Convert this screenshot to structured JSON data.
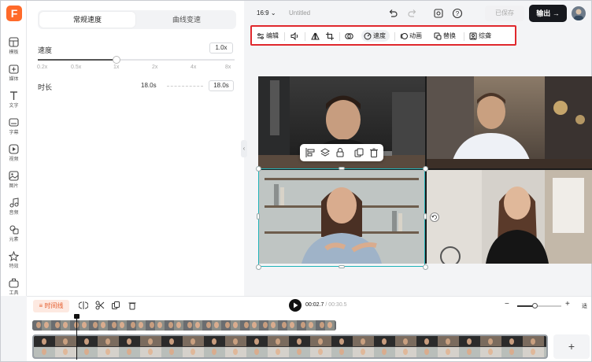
{
  "app": {
    "logo": "F"
  },
  "nav": {
    "items": [
      {
        "label": "模板",
        "icon": "template-icon"
      },
      {
        "label": "媒体",
        "icon": "media-icon"
      },
      {
        "label": "文字",
        "icon": "text-icon"
      },
      {
        "label": "字幕",
        "icon": "subtitle-icon"
      },
      {
        "label": "视频",
        "icon": "video-icon"
      },
      {
        "label": "图片",
        "icon": "image-icon"
      },
      {
        "label": "音频",
        "icon": "audio-icon"
      },
      {
        "label": "元素",
        "icon": "elements-icon"
      },
      {
        "label": "特效",
        "icon": "effects-icon"
      },
      {
        "label": "工具",
        "icon": "tools-icon"
      }
    ]
  },
  "panel": {
    "tab_regular": "常规速度",
    "tab_curve": "曲线变速",
    "speed_label": "速度",
    "speed_value": "1.0x",
    "speed_fraction": 0.4,
    "ticks": [
      "0.2x",
      "0.5x",
      "1x",
      "2x",
      "4x",
      "8x"
    ],
    "duration_label": "时长",
    "duration_from": "18.0s",
    "duration_to": "18.0s"
  },
  "topbar": {
    "ratio": "16:9",
    "title": "Untitled",
    "saved": "已保存",
    "export": "输出"
  },
  "editbar": {
    "edit": "编辑",
    "speed": "速度",
    "animation": "动画",
    "replace": "替换",
    "caption": "综聋"
  },
  "timeline": {
    "tl_button": "时间线",
    "current": "00:02.7",
    "total": "/ 00:30.5",
    "zoom_level": 0.4,
    "fit": "适",
    "add": "+"
  },
  "colors": {
    "accent": "#ff6a2a",
    "highlight_box": "#e0282d",
    "selection": "#1fb3b8"
  }
}
